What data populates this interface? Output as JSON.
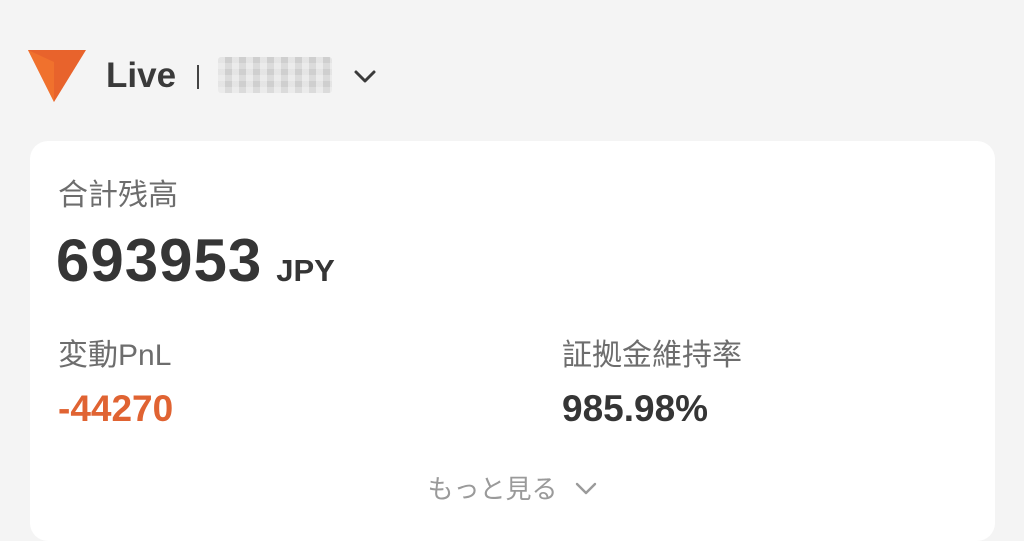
{
  "header": {
    "mode_label": "Live",
    "account_name": "",
    "logo_icon": "triangle-logo-icon",
    "dropdown_icon": "chevron-down-icon"
  },
  "summary": {
    "total_balance_label": "合計残高",
    "total_balance_value": "693953",
    "currency": "JPY",
    "pnl_label": "変動PnL",
    "pnl_value": "-44270",
    "margin_ratio_label": "証拠金維持率",
    "margin_ratio_value": "985.98%",
    "more_label": "もっと見る"
  },
  "colors": {
    "brand": "#e8632c",
    "negative": "#e06332",
    "background": "#f4f4f4",
    "card": "#ffffff",
    "text_primary": "#353535",
    "text_secondary": "#6d6d6d",
    "text_muted": "#9a9a9a"
  }
}
